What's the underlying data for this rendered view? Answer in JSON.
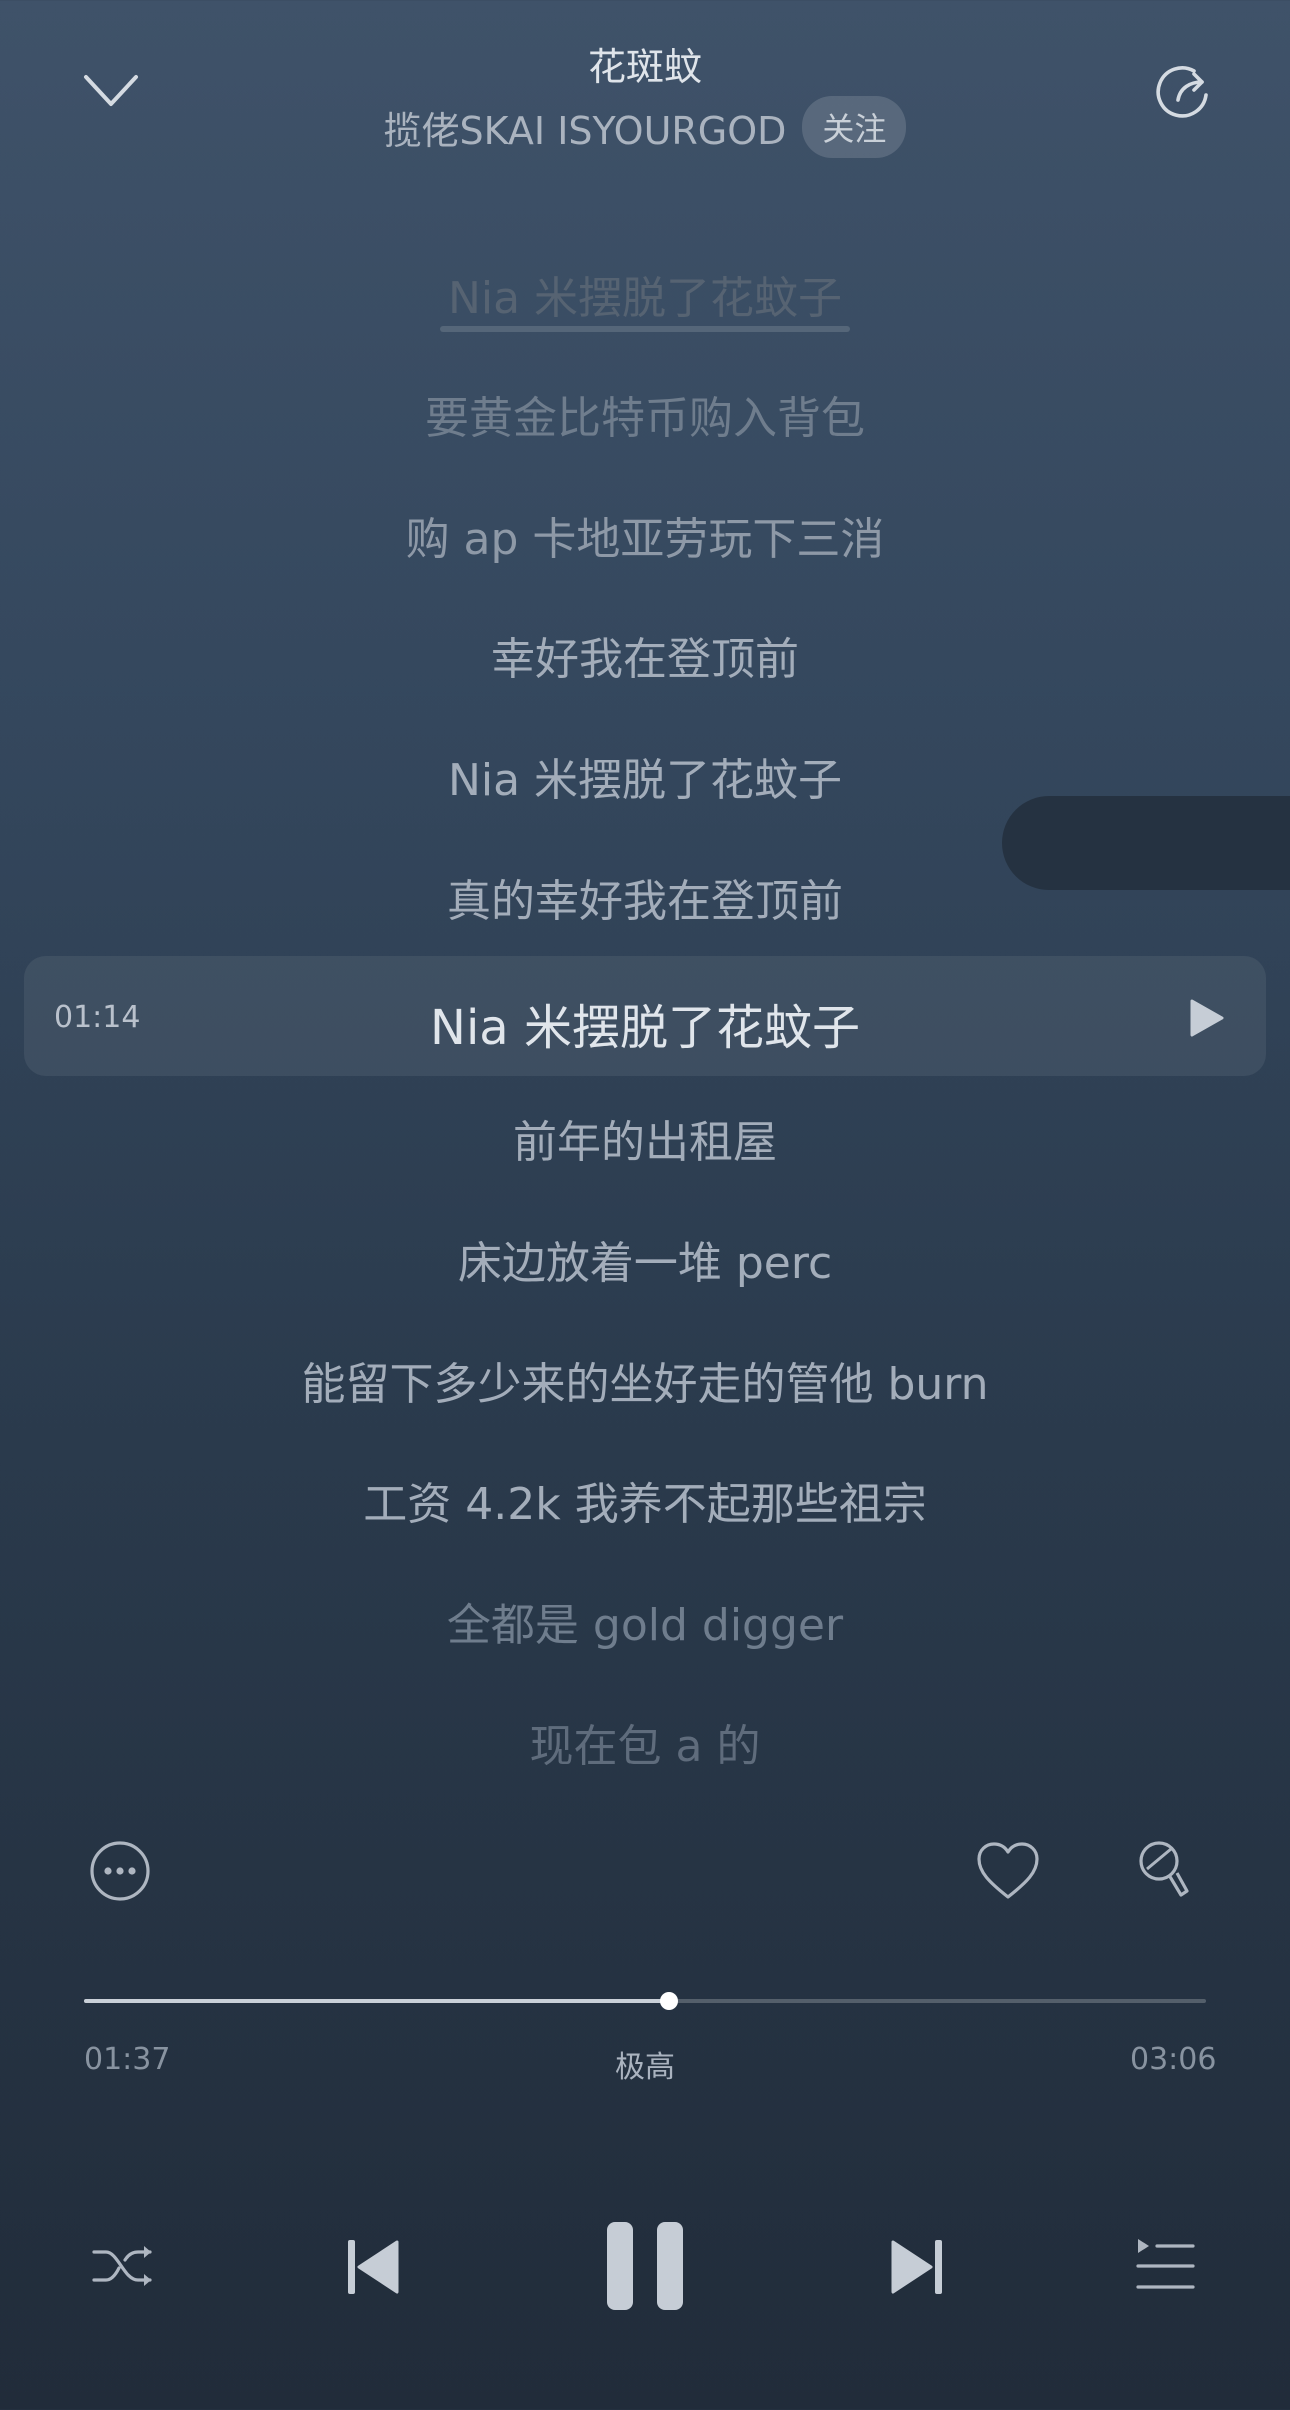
{
  "header": {
    "title": "花斑蚊",
    "artist": "揽佬SKAI ISYOURGOD",
    "follow_label": "关注",
    "collapse_icon": "chevron-down-icon",
    "share_icon": "share-icon"
  },
  "lyrics": {
    "lines": [
      "Nia 米摆脱了花蚊子",
      "要黄金比特币购入背包",
      "购 ap 卡地亚劳玩下三消",
      "幸好我在登顶前",
      "Nia 米摆脱了花蚊子",
      "真的幸好我在登顶前"
    ],
    "seek_time": "01:14",
    "seek_line": "Nia 米摆脱了花蚊子",
    "lines_after": [
      "前年的出租屋",
      "床边放着一堆 perc",
      "能留下多少来的坐好走的管他 burn",
      "工资 4.2k 我养不起那些祖宗",
      "全都是 gold digger",
      "现在包 a 的"
    ]
  },
  "actions": {
    "more_icon": "more-icon",
    "like_icon": "heart-icon",
    "sing_icon": "microphone-icon"
  },
  "progress": {
    "current": "01:37",
    "total": "03:06",
    "quality": "极高",
    "fraction": 0.5215
  },
  "transport": {
    "shuffle_icon": "shuffle-icon",
    "prev_icon": "previous-icon",
    "pause_icon": "pause-icon",
    "next_icon": "next-icon",
    "playlist_icon": "playlist-icon"
  }
}
